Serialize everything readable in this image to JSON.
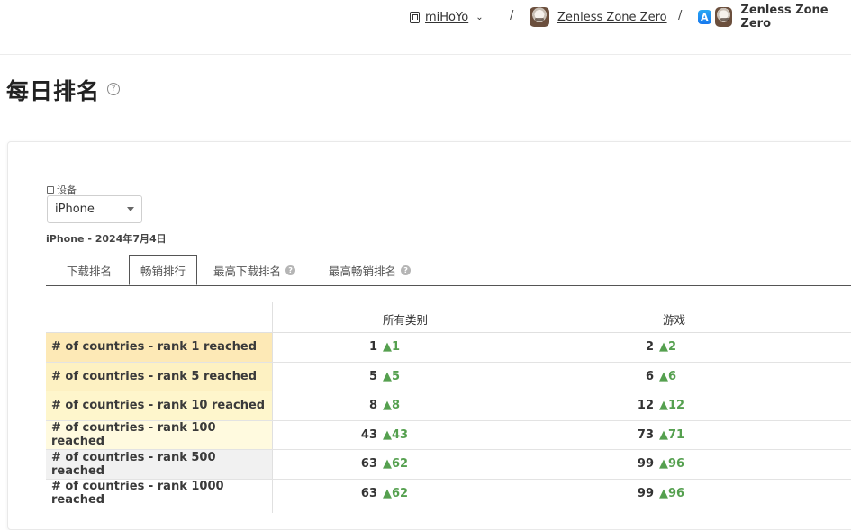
{
  "breadcrumb": {
    "publisher": "miHoYo",
    "separator": "/",
    "app_link": "Zenless Zone Zero",
    "app_current": "Zenless Zone Zero",
    "store_glyph": "A"
  },
  "page": {
    "title": "每日排名",
    "help_glyph": "?"
  },
  "device": {
    "label": "设备",
    "selected": "iPhone",
    "subinfo": "iPhone - 2024年7月4日"
  },
  "tabs": [
    {
      "label": "下载排名",
      "active": false
    },
    {
      "label": "畅销排行",
      "active": true
    },
    {
      "label": "最高下载排名",
      "active": false,
      "help": "?"
    },
    {
      "label": "最高畅销排名",
      "active": false,
      "help": "?"
    }
  ],
  "table": {
    "columns": [
      "所有类别",
      "游戏"
    ],
    "rows": [
      {
        "label": "# of countries - rank 1 reached",
        "all": "1",
        "all_delta": "▲1",
        "games": "2",
        "games_delta": "▲2",
        "bg": "#fde9b6"
      },
      {
        "label": "# of countries - rank 5 reached",
        "all": "5",
        "all_delta": "▲5",
        "games": "6",
        "games_delta": "▲6",
        "bg": "#fdf1c2"
      },
      {
        "label": "# of countries - rank 10 reached",
        "all": "8",
        "all_delta": "▲8",
        "games": "12",
        "games_delta": "▲12",
        "bg": "#fef6cc"
      },
      {
        "label": "# of countries - rank 100 reached",
        "all": "43",
        "all_delta": "▲43",
        "games": "73",
        "games_delta": "▲71",
        "bg": "#fffadf"
      },
      {
        "label": "# of countries - rank 500 reached",
        "all": "63",
        "all_delta": "▲62",
        "games": "99",
        "games_delta": "▲96",
        "bg": "#f1f1f1"
      },
      {
        "label": "# of countries - rank 1000 reached",
        "all": "63",
        "all_delta": "▲62",
        "games": "99",
        "games_delta": "▲96",
        "bg": "#ffffff"
      }
    ]
  },
  "colors": {
    "delta_green": "#55a04f",
    "tab_border": "#555555"
  },
  "icons": {
    "publisher": "building-icon",
    "chevron": "chevron-down-icon",
    "app": "zenless-app-icon",
    "store": "app-store-icon",
    "help": "help-circle-icon",
    "device": "device-icon"
  }
}
